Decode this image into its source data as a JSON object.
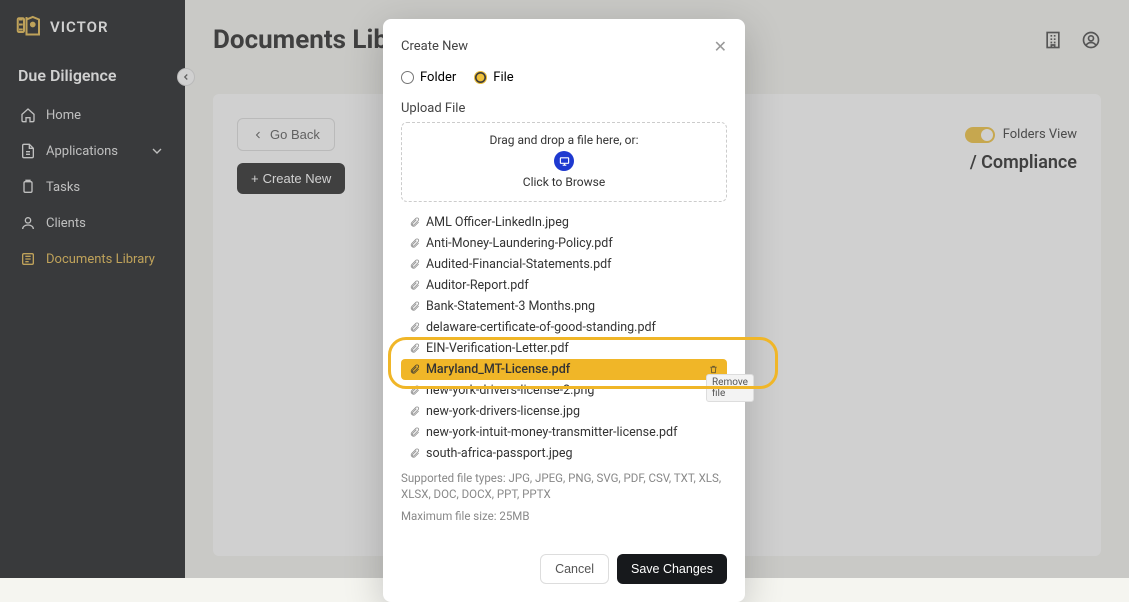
{
  "brand": {
    "name": "VICTOR"
  },
  "section": "Due Diligence",
  "nav": {
    "home": "Home",
    "applications": "Applications",
    "tasks": "Tasks",
    "clients": "Clients",
    "documents": "Documents Library"
  },
  "page": {
    "title": "Documents Library",
    "go_back": "Go Back",
    "folders_view": "Folders View",
    "breadcrumb": "/ Compliance",
    "create_new": "Create New"
  },
  "modal": {
    "title": "Create New",
    "opt_folder": "Folder",
    "opt_file": "File",
    "upload_label": "Upload File",
    "drop_text": "Drag and drop a file here, or:",
    "browse": "Click to Browse",
    "files": [
      "AML Officer-LinkedIn.jpeg",
      "Anti-Money-Laundering-Policy.pdf",
      "Audited-Financial-Statements.pdf",
      "Auditor-Report.pdf",
      "Bank-Statement-3 Months.png",
      "delaware-certificate-of-good-standing.pdf",
      "EIN-Verification-Letter.pdf",
      "Maryland_MT-License.pdf",
      "new-york-drivers-license-2.png",
      "new-york-drivers-license.jpg",
      "new-york-intuit-money-transmitter-license.pdf",
      "south-africa-passport.jpeg"
    ],
    "highlight_index": 7,
    "remove_tooltip": "Remove file",
    "hint_types": "Supported file types: JPG, JPEG, PNG, SVG, PDF, CSV, TXT, XLS, XLSX, DOC, DOCX, PPT, PPTX",
    "hint_size": "Maximum file size: 25MB",
    "cancel": "Cancel",
    "save": "Save Changes"
  }
}
